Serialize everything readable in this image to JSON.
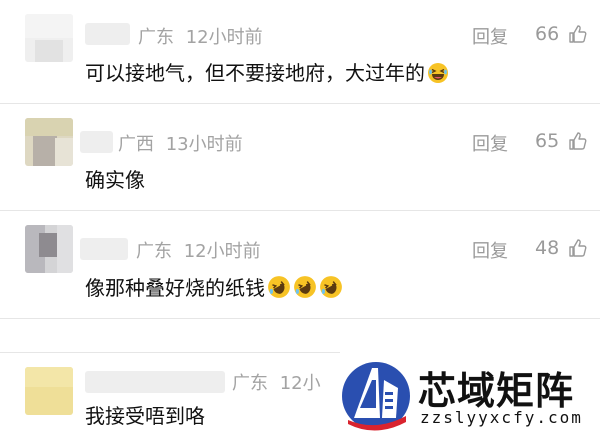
{
  "comments": [
    {
      "region": "广东",
      "time": "12小时前",
      "reply": "回复",
      "likes": "66",
      "text": "可以接地气，但不要接地府，大过年的",
      "emojis": [
        "laugh-cry"
      ]
    },
    {
      "region": "广西",
      "time": "13小时前",
      "reply": "回复",
      "likes": "65",
      "text": "确实像",
      "emojis": []
    },
    {
      "region": "广东",
      "time": "12小时前",
      "reply": "回复",
      "likes": "48",
      "text": "像那种叠好烧的纸钱",
      "emojis": [
        "rofl",
        "rofl",
        "rofl"
      ]
    },
    {
      "region": "广东",
      "time": "12小",
      "reply": "",
      "likes": "",
      "text": "我接受唔到咯",
      "emojis": []
    }
  ],
  "icons": {
    "like": "thumbs-up-icon",
    "emoji": "laughing-emoji-icon",
    "logo": "building-logo-icon"
  },
  "watermark": {
    "title": "芯域矩阵",
    "url": "zzslyyxcfy.com"
  },
  "colors": {
    "meta": "#a3a3a3",
    "text": "#111111",
    "emoji": "#f7c325",
    "logo_blue": "#2a4fb0",
    "logo_red": "#d9232e"
  }
}
